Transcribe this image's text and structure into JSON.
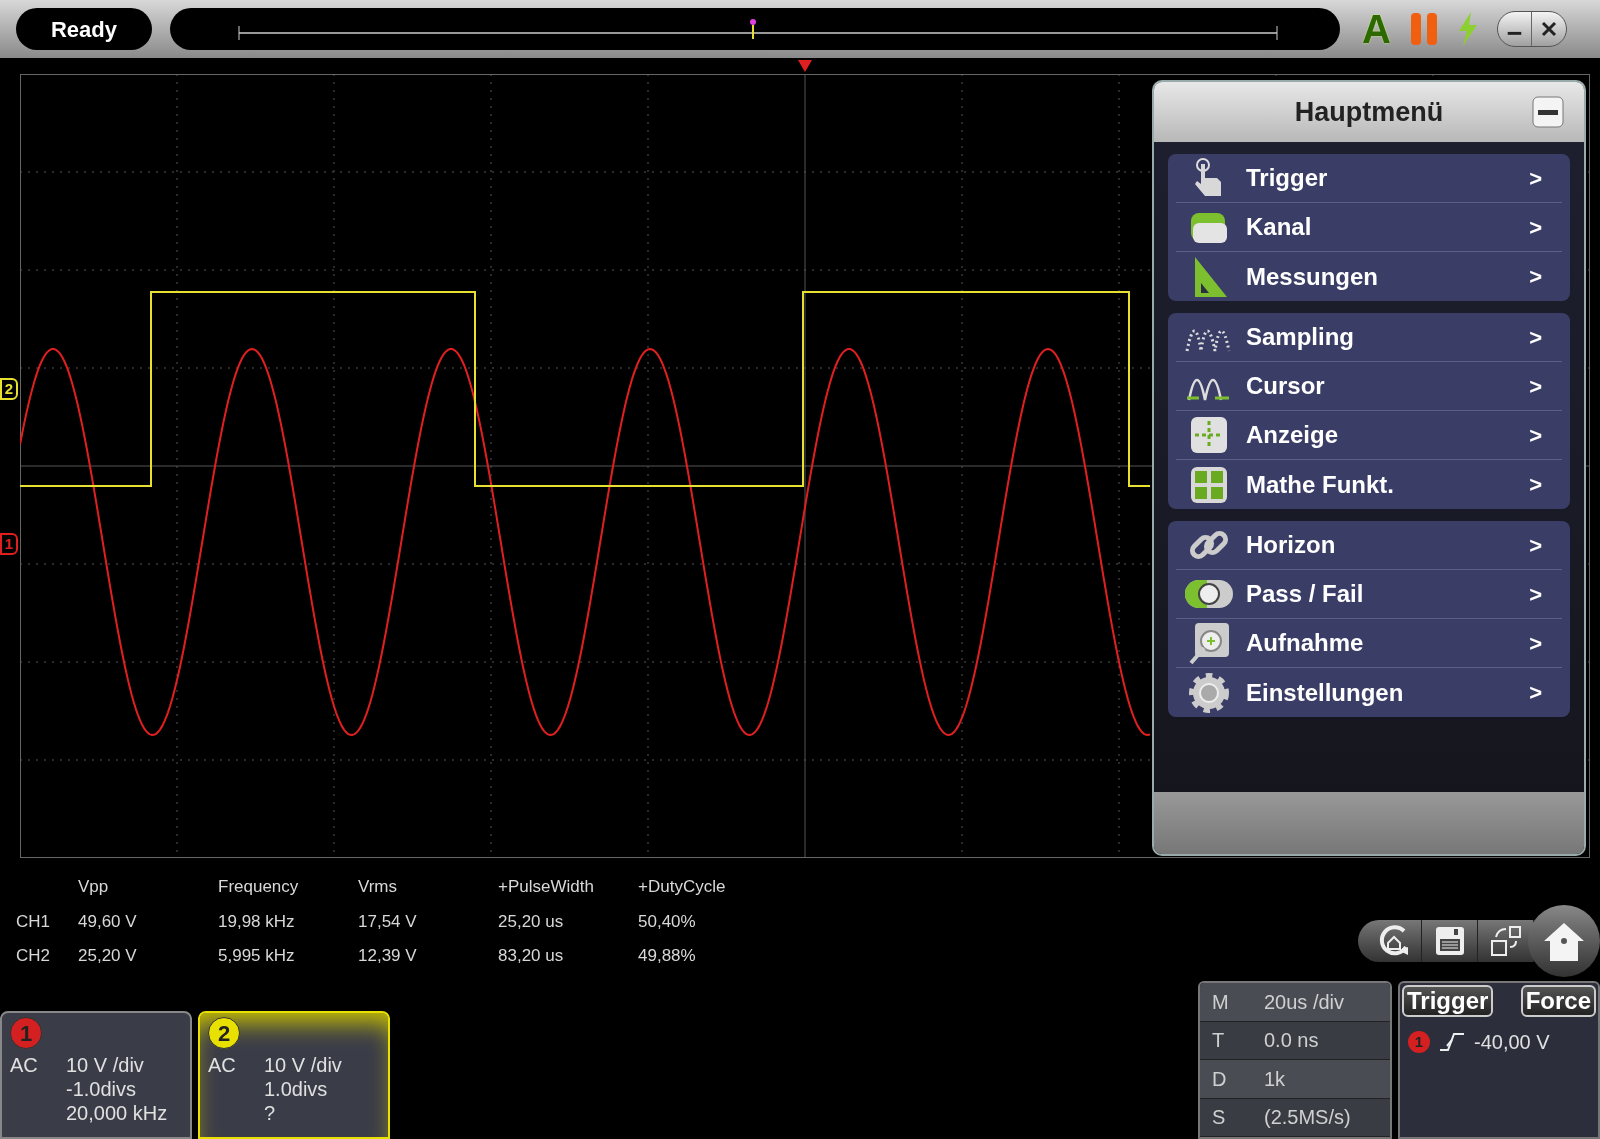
{
  "status": "Ready",
  "auto_button": "A",
  "channel_markers": [
    {
      "label": "2",
      "color": "#e8e030"
    },
    {
      "label": "1",
      "color": "#e02020"
    }
  ],
  "menu": {
    "title": "Hauptmenü",
    "groups": [
      {
        "items": [
          {
            "label": "Trigger",
            "arrow": ">"
          },
          {
            "label": "Kanal",
            "arrow": ">"
          },
          {
            "label": "Messungen",
            "arrow": ">"
          }
        ]
      },
      {
        "items": [
          {
            "label": "Sampling",
            "arrow": ">"
          },
          {
            "label": "Cursor",
            "arrow": ">"
          },
          {
            "label": "Anzeige",
            "arrow": ">"
          },
          {
            "label": "Mathe Funkt.",
            "arrow": ">"
          }
        ]
      },
      {
        "items": [
          {
            "label": "Horizon",
            "arrow": ">"
          },
          {
            "label": "Pass / Fail",
            "arrow": ">"
          },
          {
            "label": "Aufnahme",
            "arrow": ">"
          },
          {
            "label": "Einstellungen",
            "arrow": ">"
          }
        ]
      }
    ]
  },
  "measurements": {
    "columns": [
      "Vpp",
      "Frequency",
      "Vrms",
      "+PulseWidth",
      "+DutyCycle"
    ],
    "rows": [
      {
        "channel": "CH1",
        "values": [
          "49,60 V",
          "19,98 kHz",
          "17,54 V",
          "25,20 us",
          "50,40%"
        ]
      },
      {
        "channel": "CH2",
        "values": [
          "25,20 V",
          "5,995 kHz",
          "12,39 V",
          "83,20 us",
          "49,88%"
        ]
      }
    ]
  },
  "channels": [
    {
      "number": "1",
      "color": "#d42020",
      "selected": false,
      "coupling": "AC",
      "lines": [
        "10 V /div",
        "-1.0divs",
        "20,000 kHz"
      ]
    },
    {
      "number": "2",
      "color": "#e8e000",
      "selected": true,
      "coupling": "AC",
      "lines": [
        "10 V /div",
        "1.0divs",
        "?"
      ]
    }
  ],
  "timebase": [
    {
      "key": "M",
      "value": "20us /div"
    },
    {
      "key": "T",
      "value": "0.0 ns"
    },
    {
      "key": "D",
      "value": "1k"
    },
    {
      "key": "S",
      "value": "(2.5MS/s)"
    }
  ],
  "trigger": {
    "buttons": [
      "Trigger",
      "Force"
    ],
    "source": "1",
    "level": "-40,00 V"
  }
}
